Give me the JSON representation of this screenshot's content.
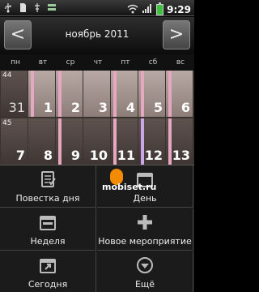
{
  "status_bar": {
    "time": "9:29",
    "icons": [
      "usb-icon",
      "sd-card-icon",
      "usb-debug-icon",
      "wifi-icon",
      "signal-icon",
      "battery-icon"
    ]
  },
  "header": {
    "month_title": "ноябрь 2011",
    "prev_label": "<",
    "next_label": ">"
  },
  "weekdays": [
    "пн",
    "вт",
    "ср",
    "чт",
    "пт",
    "сб",
    "вс"
  ],
  "weeks": [
    {
      "number": "44",
      "days": [
        "31",
        "1",
        "2",
        "3",
        "4",
        "5",
        "6"
      ]
    },
    {
      "number": "45",
      "days": [
        "7",
        "8",
        "9",
        "10",
        "11",
        "12",
        "13"
      ]
    }
  ],
  "menu": {
    "items": [
      {
        "label": "Повестка дня",
        "icon": "agenda-icon"
      },
      {
        "label": "День",
        "icon": "day-icon"
      },
      {
        "label": "Неделя",
        "icon": "week-icon"
      },
      {
        "label": "Новое мероприятие",
        "icon": "plus-icon"
      },
      {
        "label": "Сегодня",
        "icon": "today-icon"
      },
      {
        "label": "Ещё",
        "icon": "more-icon"
      }
    ]
  },
  "watermark": "mobiset.ru",
  "colors": {
    "event_pink": "#e6a8c0",
    "event_purple": "#c8a6e8",
    "watermark_orange": "#f28b00"
  }
}
